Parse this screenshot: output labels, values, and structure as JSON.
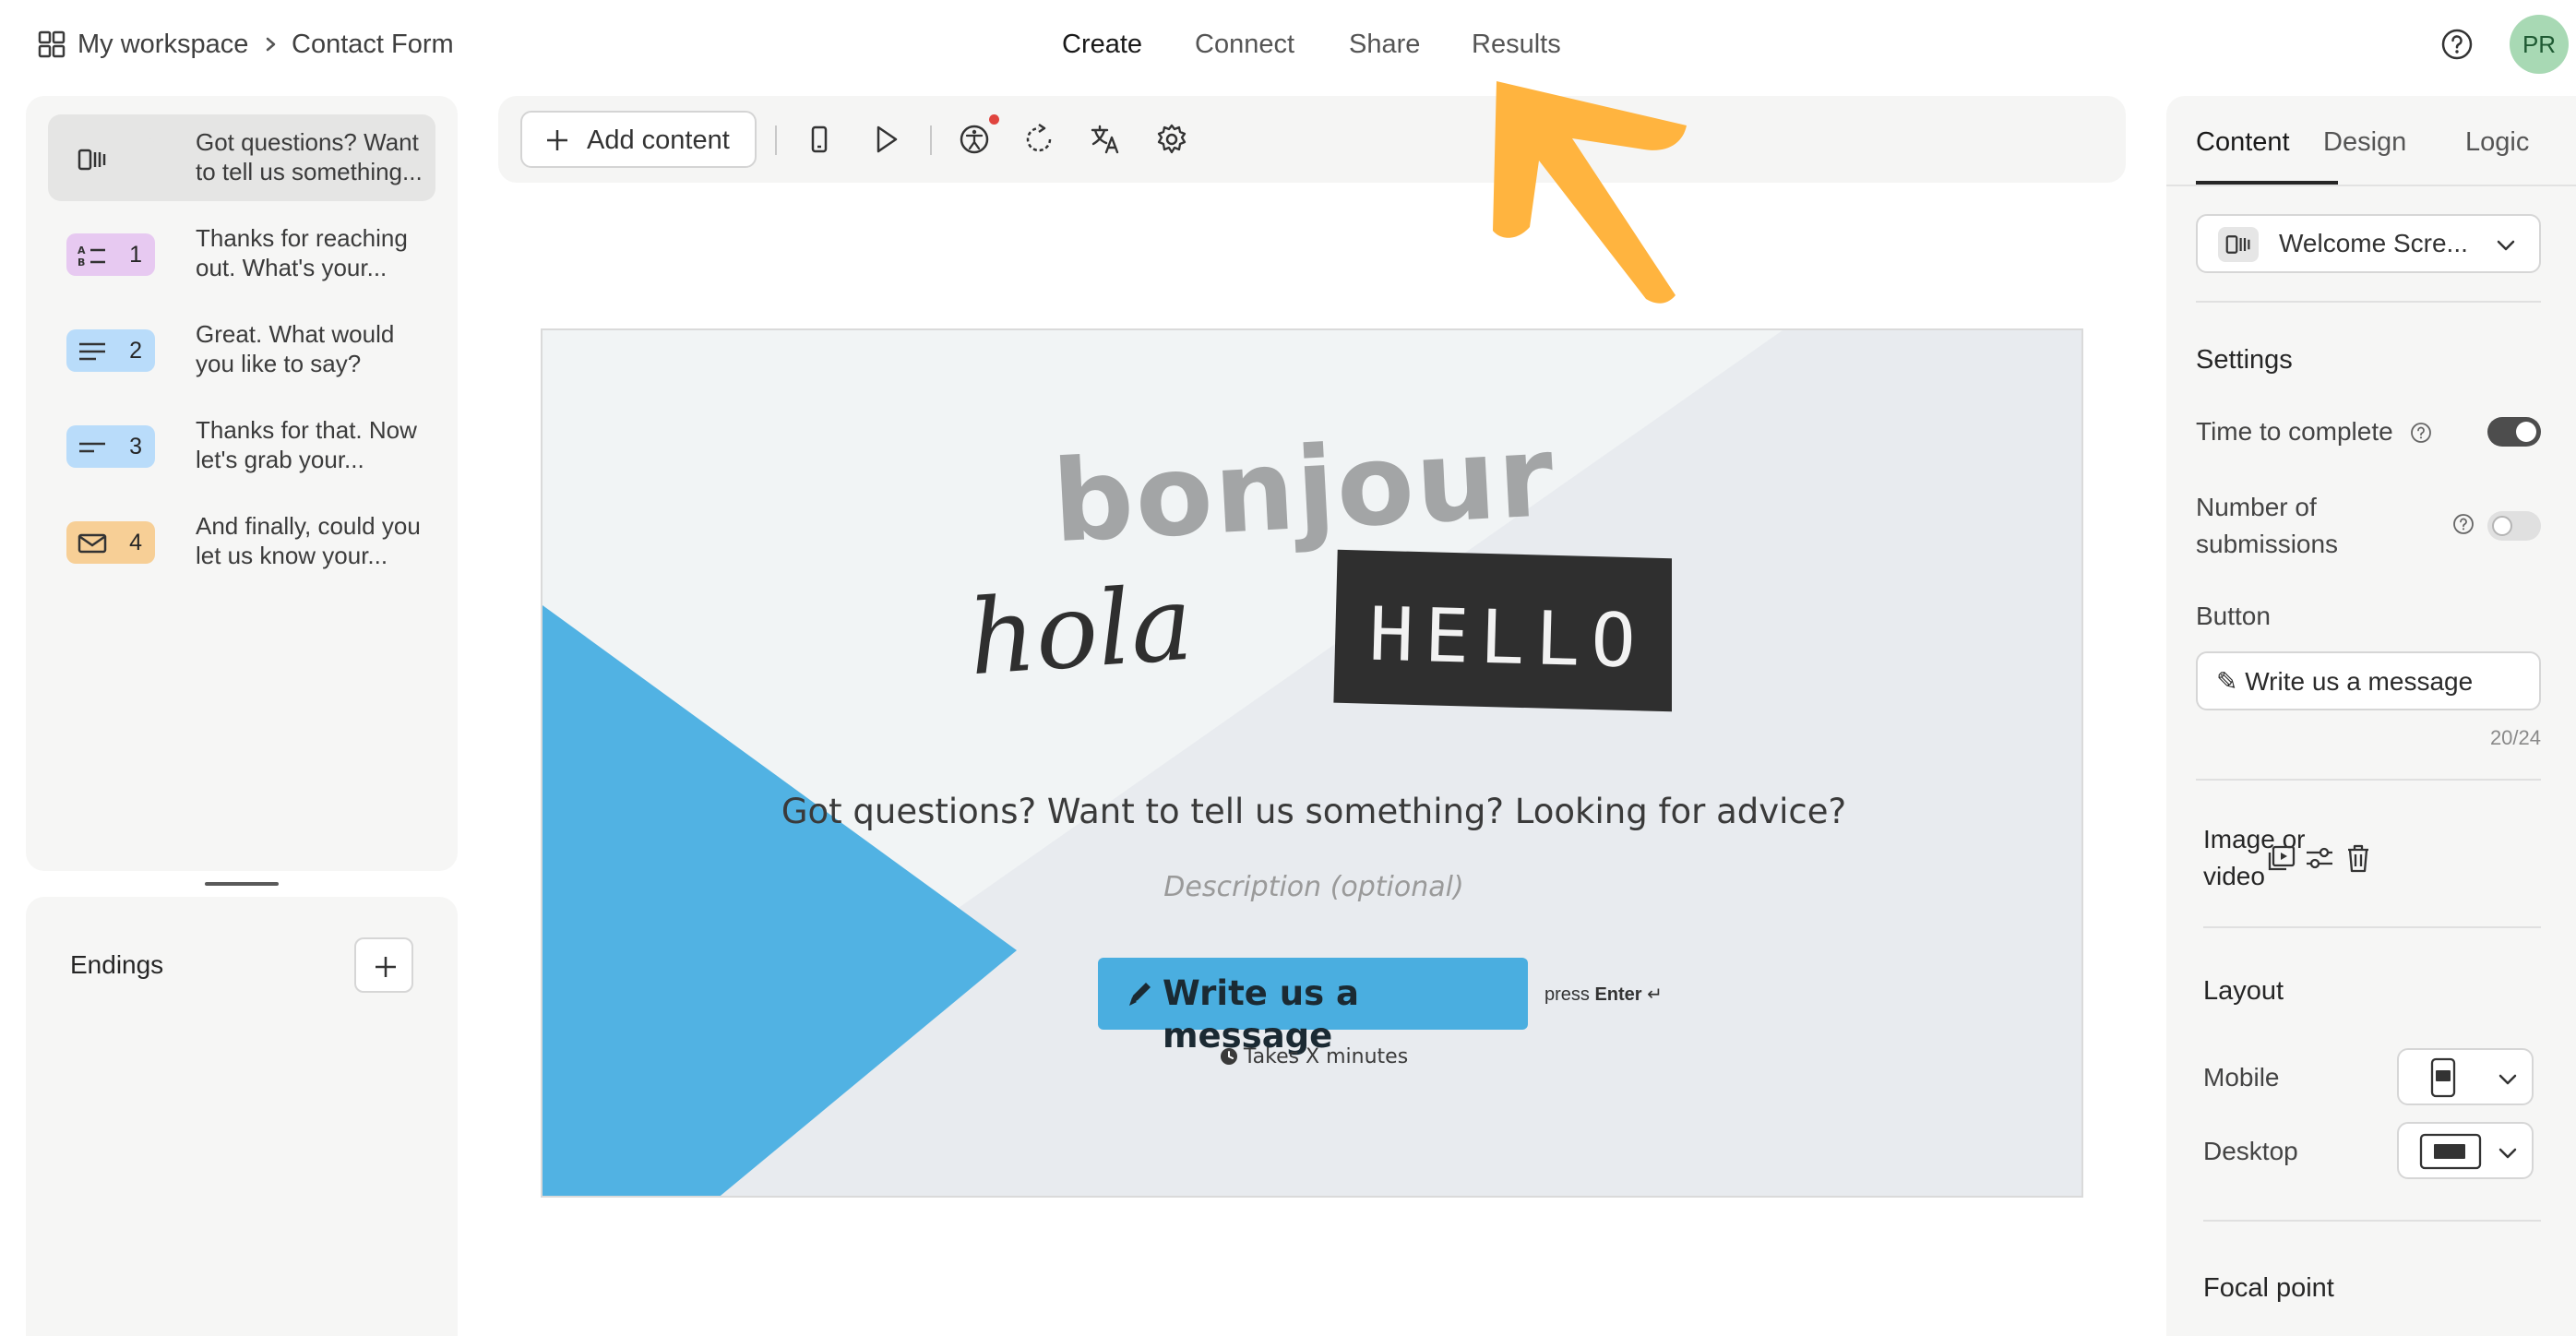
{
  "breadcrumb": {
    "workspace": "My workspace",
    "form": "Contact Form"
  },
  "nav": {
    "tabs": [
      {
        "label": "Create",
        "active": true
      },
      {
        "label": "Connect"
      },
      {
        "label": "Share"
      },
      {
        "label": "Results"
      }
    ]
  },
  "user": {
    "initials": "PR"
  },
  "questions": [
    {
      "number": "",
      "type_icon": "welcome-screen-icon",
      "text": "Got questions? Want to tell us something...",
      "color": "#e5e5e4"
    },
    {
      "number": "1",
      "type_icon": "multiple-choice-icon",
      "text": "Thanks for reaching out. What's your...",
      "color": "#e7c9f1"
    },
    {
      "number": "2",
      "type_icon": "long-text-icon",
      "text": "Great. What would you like to say?",
      "color": "#b9dcfa"
    },
    {
      "number": "3",
      "type_icon": "short-text-icon",
      "text": "Thanks for that. Now let's grab your...",
      "color": "#b9dcfa"
    },
    {
      "number": "4",
      "type_icon": "email-icon",
      "text": "And finally, could you let us know your...",
      "color": "#f7cf96"
    }
  ],
  "endings": {
    "label": "Endings"
  },
  "toolbar": {
    "add_content": "Add content"
  },
  "canvas": {
    "hero_words": {
      "word1": "bonjour",
      "word2": "hola",
      "word3": "HELLO"
    },
    "title": "Got questions? Want to tell us something? Looking for advice?",
    "description_placeholder": "Description (optional)",
    "button_label": "Write us a message",
    "press": "press",
    "enter": "Enter",
    "enter_glyph": "↵",
    "takes_time": "Takes X minutes",
    "accent_color": "#4aaee0"
  },
  "right_panel": {
    "tabs": [
      {
        "label": "Content",
        "active": true
      },
      {
        "label": "Design"
      },
      {
        "label": "Logic"
      }
    ],
    "block_type": "Welcome Scre...",
    "settings_heading": "Settings",
    "time_to_complete": {
      "label": "Time to complete",
      "enabled": true
    },
    "submissions": {
      "label": "Number of submissions",
      "enabled": false
    },
    "button": {
      "heading": "Button",
      "value": "✎ Write us a message",
      "counter": "20/24"
    },
    "image_or_video": "Image or video",
    "layout": {
      "heading": "Layout",
      "mobile": "Mobile",
      "desktop": "Desktop"
    },
    "focal_point": "Focal point"
  },
  "annotation": {
    "arrow_color": "#ffb43f",
    "points_to": "Results"
  }
}
